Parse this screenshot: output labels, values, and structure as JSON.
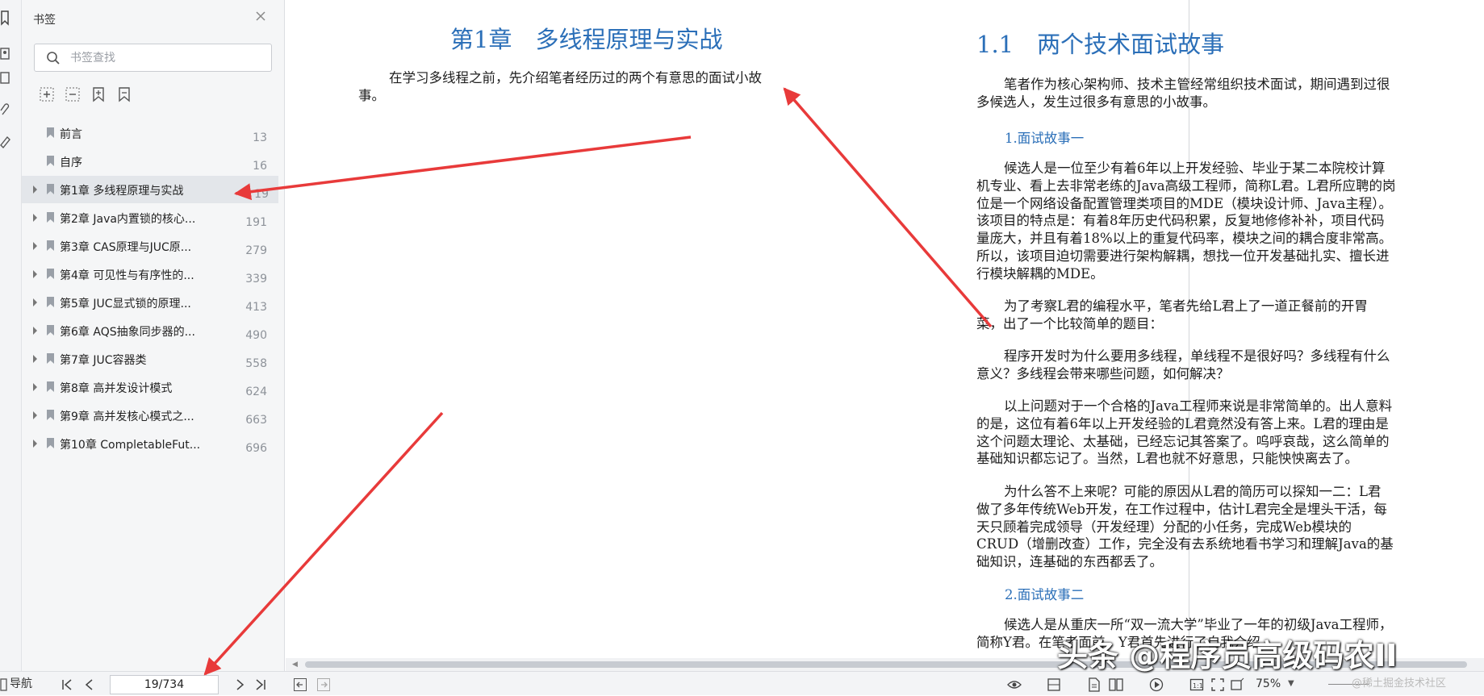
{
  "panel": {
    "title": "书签",
    "search_placeholder": "书签查找",
    "bookmarks": [
      {
        "label": "前言",
        "page": "13",
        "expandable": false
      },
      {
        "label": "自序",
        "page": "16",
        "expandable": false
      },
      {
        "label": "第1章 多线程原理与实战",
        "page": "19",
        "expandable": true,
        "selected": true
      },
      {
        "label": "第2章 Java内置锁的核心...",
        "page": "191",
        "expandable": true
      },
      {
        "label": "第3章 CAS原理与JUC原...",
        "page": "279",
        "expandable": true
      },
      {
        "label": "第4章 可见性与有序性的...",
        "page": "339",
        "expandable": true
      },
      {
        "label": "第5章 JUC显式锁的原理...",
        "page": "413",
        "expandable": true
      },
      {
        "label": "第6章 AQS抽象同步器的...",
        "page": "490",
        "expandable": true
      },
      {
        "label": "第7章 JUC容器类",
        "page": "558",
        "expandable": true
      },
      {
        "label": "第8章 高并发设计模式",
        "page": "624",
        "expandable": true
      },
      {
        "label": "第9章 高并发核心模式之...",
        "page": "663",
        "expandable": true
      },
      {
        "label": "第10章 CompletableFut...",
        "page": "696",
        "expandable": true
      }
    ]
  },
  "left_page": {
    "chapter_title": "第1章　多线程原理与实战",
    "intro_line1": "在学习多线程之前，先介绍笔者经历过的两个有意思的面试小故",
    "intro_line2": "事。"
  },
  "right_page": {
    "section_title": "1.1　两个技术面试故事",
    "p1": [
      "笔者作为核心架构师、技术主管经常组织技术面试，期间遇到过很",
      "多候选人，发生过很多有意思的小故事。"
    ],
    "sub1": "1.面试故事一",
    "p2": [
      "候选人是一位至少有着6年以上开发经验、毕业于某二本院校计算",
      "机专业、看上去非常老练的Java高级工程师，简称L君。L君所应聘的岗",
      "位是一个网络设备配置管理类项目的MDE（模块设计师、Java主程）。",
      "该项目的特点是：有着8年历史代码积累，反复地修修补补，项目代码",
      "量庞大，并且有着18%以上的重复代码率，模块之间的耦合度非常高。",
      "所以，该项目迫切需要进行架构解耦，想找一位开发基础扎实、擅长进",
      "行模块解耦的MDE。"
    ],
    "p3": [
      "为了考察L君的编程水平，笔者先给L君上了一道正餐前的开胃",
      "菜，出了一个比较简单的题目："
    ],
    "p4": [
      "程序开发时为什么要用多线程，单线程不是很好吗？多线程有什么",
      "意义？多线程会带来哪些问题，如何解决？"
    ],
    "p5": [
      "以上问题对于一个合格的Java工程师来说是非常简单的。出人意料",
      "的是，这位有着6年以上开发经验的L君竟然没有答上来。L君的理由是",
      "这个问题太理论、太基础，已经忘记其答案了。呜呼哀哉，这么简单的",
      "基础知识都忘记了。当然，L君也就不好意思，只能怏怏离去了。"
    ],
    "p6": [
      "为什么答不上来呢？可能的原因从L君的简历可以探知一二：L君",
      "做了多年传统Web开发，在工作过程中，估计L君完全是埋头干活，每",
      "天只顾着完成领导（开发经理）分配的小任务，完成Web模块的",
      "CRUD（增删改查）工作，完全没有去系统地看书学习和理解Java的基",
      "础知识，连基础的东西都丢了。"
    ],
    "sub2": "2.面试故事二",
    "p7": [
      "候选人是从重庆一所“双一流大学”毕业了一年的初级Java工程师，",
      "简称Y君。在笔者面前，Y君首先进行了自我介绍"
    ]
  },
  "status": {
    "nav_label": "导航",
    "page_indicator": "19/734",
    "zoom": "75%"
  },
  "watermark": {
    "main": "头条 @程序员高级码农II",
    "sub": "@稀土掘金技术社区"
  },
  "colors": {
    "heading": "#2b6fb8",
    "annotation_arrow": "#e83a3a",
    "selected_bookmark": "#e3e6ea"
  }
}
